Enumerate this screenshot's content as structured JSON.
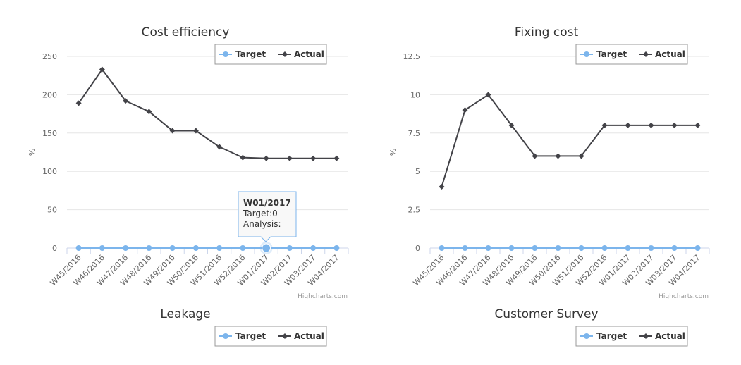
{
  "colors": {
    "target": "#7cb5ec",
    "actual": "#434348",
    "grid": "#e6e6e6",
    "axis": "#ccd6eb"
  },
  "legend": {
    "target": "Target",
    "actual": "Actual"
  },
  "credits": "Highcharts.com",
  "tooltip": {
    "title": "W01/2017",
    "target_text": "Target:0",
    "analysis_text": "Analysis:"
  },
  "chart_data": [
    {
      "type": "line",
      "title": "Cost efficiency",
      "ylabel": "%",
      "legend_position": "top-right",
      "categories": [
        "W45/2016",
        "W46/2016",
        "W47/2016",
        "W48/2016",
        "W49/2016",
        "W50/2016",
        "W51/2016",
        "W52/2016",
        "W01/2017",
        "W02/2017",
        "W03/2017",
        "W04/2017"
      ],
      "ylim": [
        0,
        250
      ],
      "yticks": [
        "0",
        "50",
        "100",
        "150",
        "200",
        "250"
      ],
      "series": [
        {
          "name": "Target",
          "values": [
            0,
            0,
            0,
            0,
            0,
            0,
            0,
            0,
            0,
            0,
            0,
            0
          ]
        },
        {
          "name": "Actual",
          "values": [
            189,
            233,
            192,
            178,
            153,
            153,
            132,
            118,
            117,
            117,
            117,
            117
          ]
        }
      ]
    },
    {
      "type": "line",
      "title": "Fixing cost",
      "ylabel": "%",
      "legend_position": "top-right",
      "categories": [
        "W45/2016",
        "W46/2016",
        "W47/2016",
        "W48/2016",
        "W49/2016",
        "W50/2016",
        "W51/2016",
        "W52/2016",
        "W01/2017",
        "W02/2017",
        "W03/2017",
        "W04/2017"
      ],
      "ylim": [
        0,
        12.5
      ],
      "yticks": [
        "0",
        "2.5",
        "5",
        "7.5",
        "10",
        "12.5"
      ],
      "series": [
        {
          "name": "Target",
          "values": [
            0,
            0,
            0,
            0,
            0,
            0,
            0,
            0,
            0,
            0,
            0,
            0
          ]
        },
        {
          "name": "Actual",
          "values": [
            4,
            9,
            10,
            8,
            6,
            6,
            6,
            8,
            8,
            8,
            8,
            8
          ]
        }
      ]
    },
    {
      "type": "line",
      "title": "Leakage",
      "legend_position": "top-right"
    },
    {
      "type": "line",
      "title": "Customer Survey",
      "legend_position": "top-right"
    }
  ]
}
